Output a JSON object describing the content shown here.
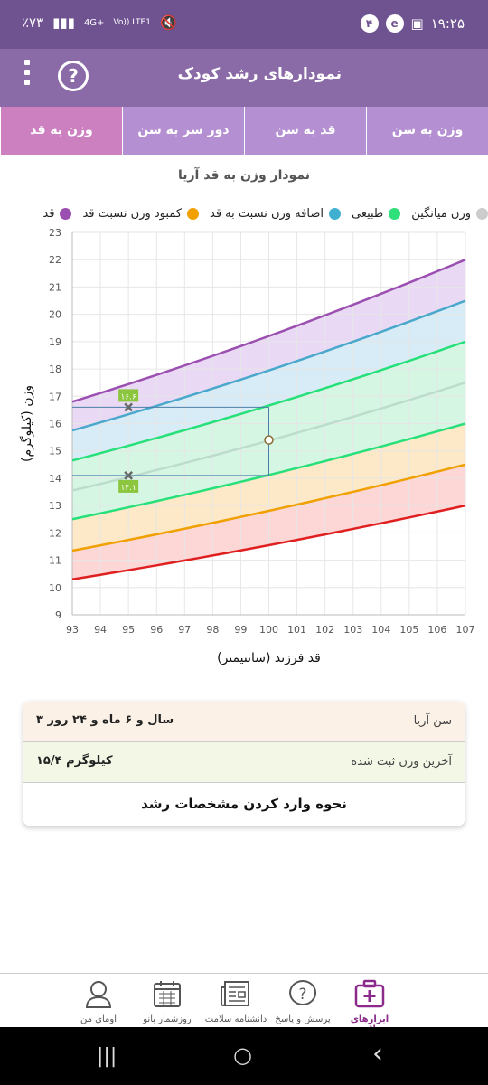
{
  "status_bar": {
    "time": "۱۹:۲۵",
    "battery": "٪۷۳",
    "notification_count": "۴",
    "network": "4G+",
    "volte": "Vo)) LTE1"
  },
  "app_bar": {
    "title": "نمودارهای رشد کودک",
    "help_glyph": "?"
  },
  "tabs": [
    {
      "label": "وزن به سن",
      "active": false
    },
    {
      "label": "قد به سن",
      "active": false
    },
    {
      "label": "دور سر به سن",
      "active": false
    },
    {
      "label": "وزن به قد",
      "active": true
    }
  ],
  "chart_title": "نمودار وزن به قد آریا",
  "chart_data": {
    "type": "line",
    "title": "نمودار وزن به قد آریا",
    "xlabel": "قد فرزند (سانتیمتر)",
    "ylabel": "وزن (کیلوگرم)",
    "xlim": [
      93,
      107
    ],
    "ylim": [
      9,
      23
    ],
    "x_ticks": [
      93,
      94,
      95,
      96,
      97,
      98,
      99,
      100,
      101,
      102,
      103,
      104,
      105,
      106,
      107
    ],
    "y_ticks": [
      9,
      10,
      11,
      12,
      13,
      14,
      15,
      16,
      17,
      18,
      19,
      20,
      21,
      22,
      23
    ],
    "grid": true,
    "legend_position": "top",
    "legend": [
      {
        "label": "قد",
        "color": "#9b4fb0"
      },
      {
        "label": "کمبود وزن نسبت قد",
        "color": "#f0a000"
      },
      {
        "label": "اضافه وزن نسبت به قد",
        "color": "#3fb0d0"
      },
      {
        "label": "طبیعی",
        "color": "#2fe07a"
      },
      {
        "label": "وزن میانگین",
        "color": "#cccccc"
      }
    ],
    "x": [
      93,
      107
    ],
    "series": [
      {
        "color": "#9b4fb0",
        "values": [
          16.8,
          22.0
        ]
      },
      {
        "color": "#4aa8cc",
        "values": [
          15.75,
          20.5
        ]
      },
      {
        "color": "#27e07a",
        "values": [
          14.65,
          19.0
        ]
      },
      {
        "color": "#bcdccc",
        "values": [
          13.55,
          17.5
        ]
      },
      {
        "color": "#27e07a",
        "values": [
          12.5,
          16.0
        ]
      },
      {
        "color": "#f0a000",
        "values": [
          11.35,
          14.5
        ]
      },
      {
        "color": "#e02020",
        "values": [
          10.3,
          13.0
        ]
      }
    ],
    "bands": [
      {
        "color": "#e9d9f5",
        "upper": 0,
        "lower": 1
      },
      {
        "color": "#d7ecf6",
        "upper": 1,
        "lower": 2
      },
      {
        "color": "#d6f6e4",
        "upper": 2,
        "lower": 4
      },
      {
        "color": "#fde9c8",
        "upper": 4,
        "lower": 5
      },
      {
        "color": "#fdd6d6",
        "upper": 5,
        "lower": 6
      }
    ],
    "point": {
      "x": 100,
      "y": 15.4
    },
    "markers": [
      {
        "x": 95,
        "y": 16.6,
        "label": "۱۶.۶"
      },
      {
        "x": 95,
        "y": 14.1,
        "label": "۱۴.۱"
      }
    ],
    "guide_lines": [
      {
        "from": [
          93,
          16.6
        ],
        "to": [
          100,
          16.6
        ]
      },
      {
        "from": [
          93,
          14.1
        ],
        "to": [
          100,
          14.1
        ]
      },
      {
        "from": [
          100,
          14.1
        ],
        "to": [
          100,
          16.6
        ]
      }
    ]
  },
  "info_card": {
    "age_label": "سن آریا",
    "age_value": "۳ سال و ۶ ماه و ۲۴ روز",
    "weight_label": "آخرین وزن ثبت شده",
    "weight_value": "۱۵/۴ کیلوگرم",
    "howto_label": "نحوه وارد کردن مشخصات رشد"
  },
  "bottom_nav": [
    {
      "label": "ابزارهای سلامت",
      "icon": "first-aid-kit-icon",
      "active": true
    },
    {
      "label": "پرسش و پاسخ",
      "icon": "question-bubble-icon",
      "active": false
    },
    {
      "label": "دانشنامه سلامت",
      "icon": "newspaper-icon",
      "active": false
    },
    {
      "label": "روزشمار بانو",
      "icon": "calendar-icon",
      "active": false
    },
    {
      "label": "اومای من",
      "icon": "user-profile-icon",
      "active": false
    }
  ],
  "system_nav": {
    "recent": "|||",
    "home": "○",
    "back": "‹"
  }
}
